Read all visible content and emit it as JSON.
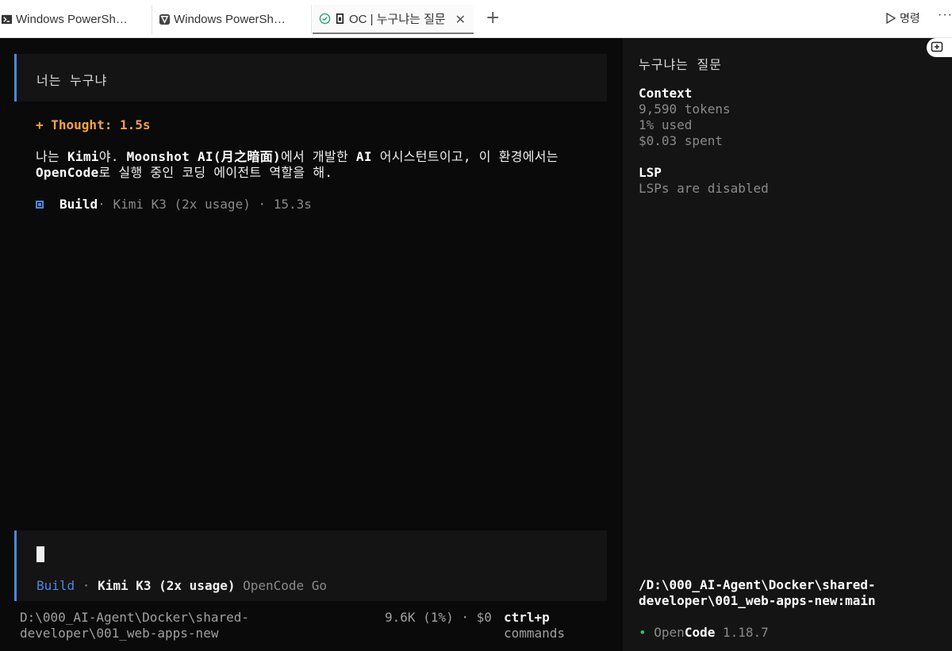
{
  "tabs": [
    {
      "label": "Windows PowerSh…",
      "icon": "terminal-icon"
    },
    {
      "label": "Windows PowerSh…",
      "icon": "powershell-icon"
    },
    {
      "label": "OC | 누구냐는 질문",
      "icon": "status-check-icon",
      "active": true
    }
  ],
  "tabbar": {
    "run_label": "명령"
  },
  "chat": {
    "user_message": "너는 누구냐",
    "thought": "+ Thought: 1.5s",
    "answer": {
      "p1": "나는 ",
      "b1": "Kimi",
      "p2": "야. ",
      "b2": "Moonshot AI(月之暗面)",
      "p3": "에서 개발한 ",
      "b3": "AI",
      "p4": " 어시스턴트이고, 이 환경에서는 ",
      "b4": "OpenCode",
      "p5": "로 실행 중인 코딩 에이전트 역할을 해."
    },
    "build": {
      "agent": "Build",
      "meta": " · Kimi K3 (2x usage) · 15.3s"
    }
  },
  "prompt": {
    "agent": "Build",
    "separator": " · ",
    "model": "Kimi K3 (2x usage)",
    "provider": " OpenCode Go"
  },
  "status": {
    "path": "D:\\000_AI-Agent\\Docker\\shared-developer\\001_web-apps-new",
    "usage": "9.6K (1%) · $0",
    "key": "ctrl+p",
    "key_desc": "commands"
  },
  "sidebar": {
    "title": "누구냐는 질문",
    "context": {
      "heading": "Context",
      "tokens": "9,590 tokens",
      "used": "1% used",
      "spent": "$0.03 spent"
    },
    "lsp": {
      "heading": "LSP",
      "status": "LSPs are disabled"
    },
    "path": "/D:\\000_AI-Agent\\Docker\\shared-developer\\001_web-apps-new:main",
    "version": {
      "dot": "•",
      "open": "Open",
      "code": "Code",
      "number": " 1.18.7"
    }
  },
  "colors": {
    "accent": "#4e88de",
    "thought": "#f5a442",
    "ok": "#2fbf71"
  }
}
